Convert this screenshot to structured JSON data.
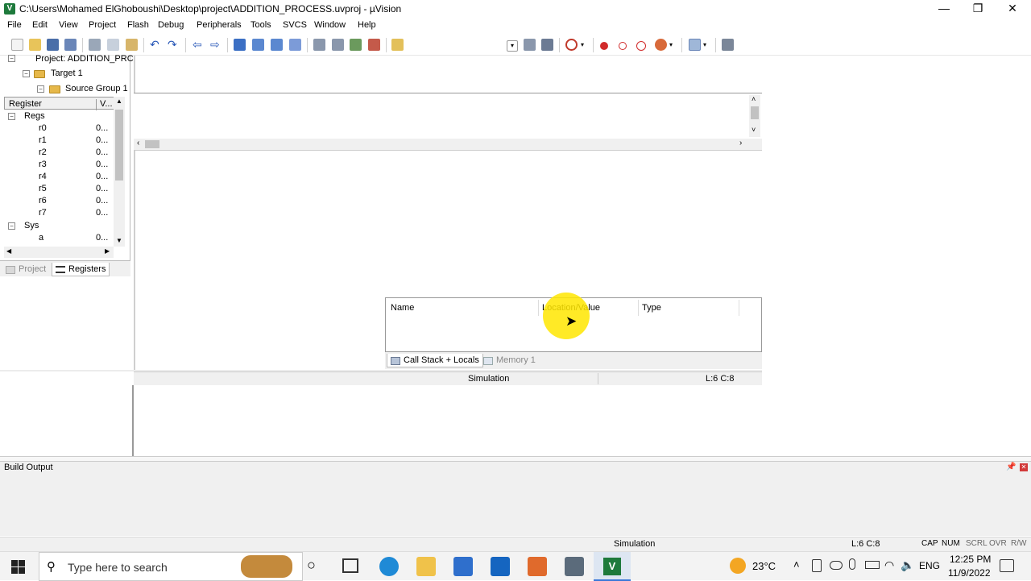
{
  "window": {
    "title": "C:\\Users\\Mohamed ElGhoboushi\\Desktop\\project\\ADDITION_PROCESS.uvproj - µVision",
    "app_icon_letter": "V",
    "controls": {
      "minimize": "—",
      "restore": "❐",
      "close": "✕"
    }
  },
  "menu": [
    "File",
    "Edit",
    "View",
    "Project",
    "Flash",
    "Debug",
    "Peripherals",
    "Tools",
    "SVCS",
    "Window",
    "Help"
  ],
  "project_tree": {
    "project": "Project: ADDITION_PRC",
    "target": "Target 1",
    "source_group": "Source Group 1"
  },
  "registers": {
    "col_register": "Register",
    "col_value": "V...",
    "group_regs": "Regs",
    "group_sys": "Sys",
    "rows": [
      {
        "name": "r0",
        "value": "0..."
      },
      {
        "name": "r1",
        "value": "0..."
      },
      {
        "name": "r2",
        "value": "0..."
      },
      {
        "name": "r3",
        "value": "0..."
      },
      {
        "name": "r4",
        "value": "0..."
      },
      {
        "name": "r5",
        "value": "0..."
      },
      {
        "name": "r6",
        "value": "0..."
      },
      {
        "name": "r7",
        "value": "0..."
      }
    ],
    "sys_rows": [
      {
        "name": "a",
        "value": "0..."
      }
    ]
  },
  "left_tabs": {
    "project": "Project",
    "registers": "Registers"
  },
  "callstack": {
    "col_name": "Name",
    "col_location": "Location/Value",
    "col_type": "Type",
    "tab_callstack": "Call Stack + Locals",
    "tab_memory": "Memory 1"
  },
  "inner_status": {
    "mode": "Simulation",
    "position": "L:6 C:8"
  },
  "build_output": {
    "title": "Build Output"
  },
  "statusbar": {
    "mode": "Simulation",
    "position": "L:6 C:8",
    "indicators": [
      "CAP",
      "NUM",
      "SCRL",
      "OVR",
      "R/W"
    ]
  },
  "taskbar": {
    "search_placeholder": "Type here to search",
    "weather": "23°C",
    "language": "ENG",
    "time": "12:25 PM",
    "date": "11/9/2022"
  }
}
